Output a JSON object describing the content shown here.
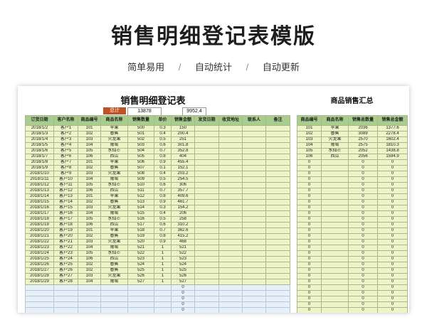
{
  "banner": {
    "title": "销售明细登记表模版",
    "features": [
      "简单易用",
      "自动统计",
      "自动更新"
    ],
    "separator": "/"
  },
  "sheet": {
    "title": "销售明细登记表",
    "summary_title": "商品销售汇总",
    "totals": {
      "label": "总计",
      "quantity": "13878",
      "amount": "9952.4"
    },
    "headers": [
      "订货日期",
      "客户名称",
      "商品编号",
      "商品名称",
      "销售数量",
      "单价",
      "销售金额",
      "发货日期",
      "收货地址",
      "联系人",
      "备注"
    ],
    "rows": [
      [
        "2018/1/2",
        "客户1",
        "101",
        "苹果",
        "500",
        "0.3",
        "150"
      ],
      [
        "2018/1/3",
        "客户2",
        "102",
        "香蕉",
        "501",
        "0.4",
        "200.4"
      ],
      [
        "2018/1/4",
        "客户3",
        "103",
        "火龙果",
        "502",
        "0.5",
        "251"
      ],
      [
        "2018/1/5",
        "客户4",
        "104",
        "葡萄",
        "503",
        "0.6",
        "301.8"
      ],
      [
        "2018/1/6",
        "客户5",
        "105",
        "水仙芒",
        "504",
        "0.7",
        "352.8"
      ],
      [
        "2018/1/7",
        "客户6",
        "106",
        "西瓜",
        "505",
        "0.8",
        "404"
      ],
      [
        "2018/1/8",
        "客户7",
        "101",
        "苹果",
        "506",
        "0.9",
        "455.4"
      ],
      [
        "2018/1/9",
        "客户8",
        "102",
        "香蕉",
        "507",
        "0.1",
        "152.1"
      ],
      [
        "2018/1/10",
        "客户9",
        "103",
        "火龙果",
        "508",
        "0.4",
        "203.2"
      ],
      [
        "2018/1/11",
        "客户10",
        "104",
        "葡萄",
        "509",
        "0.5",
        "254.5"
      ],
      [
        "2018/1/12",
        "客户11",
        "105",
        "水仙芒",
        "510",
        "0.6",
        "306"
      ],
      [
        "2018/1/13",
        "客户12",
        "106",
        "西瓜",
        "511",
        "0.7",
        "357.7"
      ],
      [
        "2018/1/14",
        "客户13",
        "101",
        "苹果",
        "512",
        "0.8",
        "409.6"
      ],
      [
        "2018/1/15",
        "客户14",
        "102",
        "香蕉",
        "513",
        "0.9",
        "461.7"
      ],
      [
        "2018/1/16",
        "客户15",
        "103",
        "火龙果",
        "514",
        "0.3",
        "154.2"
      ],
      [
        "2018/1/17",
        "客户16",
        "104",
        "葡萄",
        "515",
        "0.4",
        "206"
      ],
      [
        "2018/1/18",
        "客户17",
        "105",
        "水仙芒",
        "516",
        "0.5",
        "258"
      ],
      [
        "2018/1/19",
        "客户18",
        "106",
        "西瓜",
        "517",
        "0.6",
        "310.2"
      ],
      [
        "2018/1/20",
        "客户19",
        "101",
        "苹果",
        "518",
        "0.7",
        "362.6"
      ],
      [
        "2018/1/21",
        "客户20",
        "102",
        "香蕉",
        "519",
        "0.8",
        "415.2"
      ],
      [
        "2018/1/22",
        "客户21",
        "103",
        "火龙果",
        "520",
        "0.9",
        "468"
      ],
      [
        "2018/1/23",
        "客户22",
        "104",
        "葡萄",
        "521",
        "1",
        "521"
      ],
      [
        "2018/1/24",
        "客户23",
        "105",
        "水仙芒",
        "522",
        "1",
        "522"
      ],
      [
        "2018/1/25",
        "客户24",
        "106",
        "西瓜",
        "523",
        "1",
        "523"
      ],
      [
        "2018/1/26",
        "客户25",
        "102",
        "香蕉",
        "524",
        "1",
        "524"
      ],
      [
        "2018/1/27",
        "客户26",
        "102",
        "香蕉",
        "525",
        "1",
        "525"
      ],
      [
        "2018/1/28",
        "客户27",
        "103",
        "火龙果",
        "526",
        "1",
        "526"
      ],
      [
        "2018/1/29",
        "客户28",
        "104",
        "葡萄",
        "527",
        "1",
        "527"
      ]
    ],
    "blank_amount": "0",
    "blank_row_count": 8,
    "summary_headers": [
      "商品编号",
      "商品名称",
      "销售总数量",
      "销售总金额"
    ],
    "summary_rows": [
      [
        "101",
        "苹果",
        "2036",
        "1377.6"
      ],
      [
        "102",
        "香蕉",
        "3089",
        "2278.4"
      ],
      [
        "103",
        "火龙果",
        "2570",
        "1602.4"
      ],
      [
        "104",
        "葡萄",
        "2575",
        "1810.3"
      ],
      [
        "105",
        "水仙芒",
        "2052",
        "1438.8"
      ],
      [
        "106",
        "西瓜",
        "2056",
        "1594.9"
      ]
    ],
    "summary_zero": "0",
    "summary_zero_row_count": 30
  }
}
